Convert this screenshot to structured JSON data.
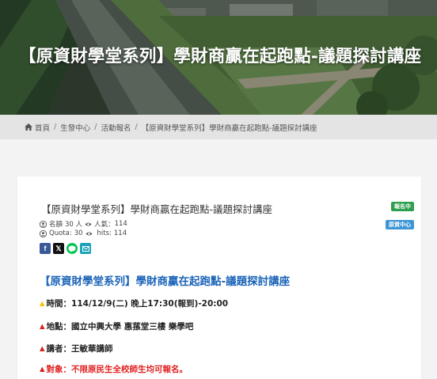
{
  "hero": {
    "title": "【原資財學堂系列】學財商贏在起跑點-議題探討講座"
  },
  "breadcrumb": {
    "items": [
      "首頁",
      "生發中心",
      "活動報名",
      "【原資財學堂系列】學財商贏在起跑點-議題探討講座"
    ],
    "separator": "/"
  },
  "event": {
    "title": "【原資財學堂系列】學財商贏在起跑點-議題探討講座",
    "status_badge": "報名中",
    "dept_badge": "原資中心",
    "meta_line1": {
      "quota_label": "名額",
      "quota_value": "30 人",
      "hits_label": "人氣：",
      "hits_value": "114"
    },
    "meta_line2": {
      "quota_label": "Quota:",
      "quota_value": "30",
      "hits_label": "hits:",
      "hits_value": "114"
    },
    "share_icons": [
      "facebook-icon",
      "x-icon",
      "line-icon",
      "email-icon"
    ]
  },
  "article": {
    "title": "【原資財學堂系列】學財商贏在起跑點-議題探討講座",
    "lines": [
      {
        "marker": "▲",
        "text": "時間：114/12/9(二) 晚上17:30(報到)-20:00"
      },
      {
        "marker": "▲",
        "text": "地點：國立中興大學 惠蓀堂三樓 樂學吧"
      },
      {
        "marker": "▲",
        "text": "講者：王敏華講師"
      },
      {
        "marker": "▲",
        "text": "對象：不限原民生全校師生均可報名。"
      }
    ]
  },
  "colors": {
    "accent_blue": "#1a63b8",
    "status_green": "#2e9e4f",
    "dept_blue": "#3d95d6",
    "alert_red": "#e02020",
    "marker_yellow": "#f5c400"
  }
}
